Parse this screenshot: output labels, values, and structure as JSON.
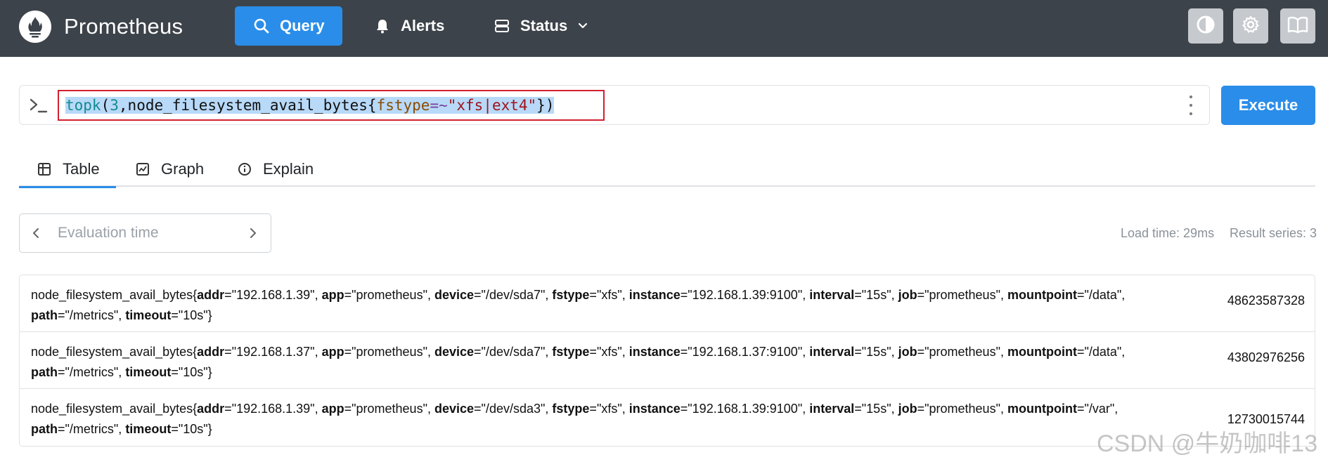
{
  "navbar": {
    "brand": "Prometheus",
    "items": [
      {
        "label": "Query",
        "icon": "search-icon",
        "active": true
      },
      {
        "label": "Alerts",
        "icon": "bell-icon"
      },
      {
        "label": "Status",
        "icon": "server-icon",
        "dropdown": true
      }
    ],
    "tools": [
      "theme-toggle-icon",
      "gear-icon",
      "book-icon"
    ]
  },
  "query": {
    "expression": "topk(3,node_filesystem_avail_bytes{fstype=~\"xfs|ext4\"})",
    "tokens": {
      "fn": "topk",
      "open": "(",
      "num": "3",
      "comma": ",",
      "metric": "node_filesystem_avail_bytes",
      "brace_open": "{",
      "label": "fstype",
      "op": "=~",
      "str": "\"xfs|ext4\"",
      "brace_close": "}",
      "close": ")"
    },
    "execute_label": "Execute"
  },
  "tabs": [
    {
      "label": "Table",
      "icon": "table-icon",
      "active": true
    },
    {
      "label": "Graph",
      "icon": "graph-icon"
    },
    {
      "label": "Explain",
      "icon": "info-icon"
    }
  ],
  "eval": {
    "placeholder": "Evaluation time"
  },
  "stats": {
    "load_time": "Load time: 29ms",
    "result_series": "Result series: 3"
  },
  "results": [
    {
      "metric": "node_filesystem_avail_bytes",
      "labels": [
        {
          "k": "addr",
          "v": "\"192.168.1.39\""
        },
        {
          "k": "app",
          "v": "\"prometheus\""
        },
        {
          "k": "device",
          "v": "\"/dev/sda7\""
        },
        {
          "k": "fstype",
          "v": "\"xfs\""
        },
        {
          "k": "instance",
          "v": "\"192.168.1.39:9100\""
        },
        {
          "k": "interval",
          "v": "\"15s\""
        },
        {
          "k": "job",
          "v": "\"prometheus\""
        },
        {
          "k": "mountpoint",
          "v": "\"/data\""
        },
        {
          "k": "path",
          "v": "\"/metrics\""
        },
        {
          "k": "timeout",
          "v": "\"10s\""
        }
      ],
      "value": "48623587328"
    },
    {
      "metric": "node_filesystem_avail_bytes",
      "labels": [
        {
          "k": "addr",
          "v": "\"192.168.1.37\""
        },
        {
          "k": "app",
          "v": "\"prometheus\""
        },
        {
          "k": "device",
          "v": "\"/dev/sda7\""
        },
        {
          "k": "fstype",
          "v": "\"xfs\""
        },
        {
          "k": "instance",
          "v": "\"192.168.1.37:9100\""
        },
        {
          "k": "interval",
          "v": "\"15s\""
        },
        {
          "k": "job",
          "v": "\"prometheus\""
        },
        {
          "k": "mountpoint",
          "v": "\"/data\""
        },
        {
          "k": "path",
          "v": "\"/metrics\""
        },
        {
          "k": "timeout",
          "v": "\"10s\""
        }
      ],
      "value": "43802976256"
    },
    {
      "metric": "node_filesystem_avail_bytes",
      "labels": [
        {
          "k": "addr",
          "v": "\"192.168.1.39\""
        },
        {
          "k": "app",
          "v": "\"prometheus\""
        },
        {
          "k": "device",
          "v": "\"/dev/sda3\""
        },
        {
          "k": "fstype",
          "v": "\"xfs\""
        },
        {
          "k": "instance",
          "v": "\"192.168.1.39:9100\""
        },
        {
          "k": "interval",
          "v": "\"15s\""
        },
        {
          "k": "job",
          "v": "\"prometheus\""
        },
        {
          "k": "mountpoint",
          "v": "\"/var\""
        },
        {
          "k": "path",
          "v": "\"/metrics\""
        },
        {
          "k": "timeout",
          "v": "\"10s\""
        }
      ],
      "value": "12730015744"
    }
  ],
  "watermark": "CSDN @牛奶咖啡13",
  "colors": {
    "accent": "#2a8de9",
    "navbar": "#3d434a",
    "highlight_border": "#d2202f"
  }
}
